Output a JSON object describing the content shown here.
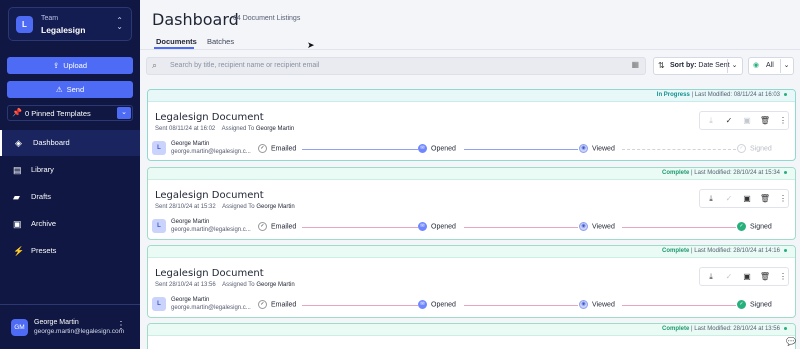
{
  "team": {
    "label": "Team",
    "name": "Legalesign",
    "initial": "L"
  },
  "actions": {
    "upload": "Upload",
    "send": "Send"
  },
  "pinned": {
    "label": "0 Pinned Templates"
  },
  "nav": [
    {
      "label": "Dashboard",
      "active": true
    },
    {
      "label": "Library"
    },
    {
      "label": "Drafts"
    },
    {
      "label": "Archive"
    },
    {
      "label": "Presets"
    }
  ],
  "user": {
    "initials": "GM",
    "name": "George Martin",
    "email": "george.martin@legalesign.com"
  },
  "header": {
    "title": "Dashboard",
    "count": "64 Document Listings"
  },
  "tabs": [
    {
      "label": "Documents",
      "active": true
    },
    {
      "label": "Batches"
    }
  ],
  "search": {
    "placeholder": "Search by title, recipient name or recipient email"
  },
  "sort": {
    "prefix": "Sort by:",
    "value": "Date Sent"
  },
  "filter": {
    "value": "All"
  },
  "cards": [
    {
      "status": "In Progress",
      "modified": "| Last Modified: 08/11/24 at 16:03",
      "title": "Legalesign Document",
      "sent": "Sent 08/11/24 at 16:02",
      "assigned_prefix": "Assigned To",
      "assigned": "George Martin",
      "recipient_name": "George Martin",
      "recipient_email": "george.martin@legalesign.c...",
      "steps": [
        "Emailed",
        "Opened",
        "Viewed",
        "Signed"
      ]
    },
    {
      "status": "Complete",
      "modified": "| Last Modified: 28/10/24 at 15:34",
      "title": "Legalesign Document",
      "sent": "Sent 28/10/24 at 15:32",
      "assigned_prefix": "Assigned To",
      "assigned": "George Martin",
      "recipient_name": "George Martin",
      "recipient_email": "george.martin@legalesign.c...",
      "steps": [
        "Emailed",
        "Opened",
        "Viewed",
        "Signed"
      ]
    },
    {
      "status": "Complete",
      "modified": "| Last Modified: 28/10/24 at 14:16",
      "title": "Legalesign Document",
      "sent": "Sent 28/10/24 at 13:56",
      "assigned_prefix": "Assigned To",
      "assigned": "George Martin",
      "recipient_name": "George Martin",
      "recipient_email": "george.martin@legalesign.c...",
      "steps": [
        "Emailed",
        "Opened",
        "Viewed",
        "Signed"
      ]
    },
    {
      "status": "Complete",
      "modified": "| Last Modified: 28/10/24 at 13:56"
    }
  ],
  "colors": {
    "sidebar": "#0f1742",
    "accent": "#4e6bf5",
    "complete": "#27b07c",
    "progress": "#139090"
  }
}
